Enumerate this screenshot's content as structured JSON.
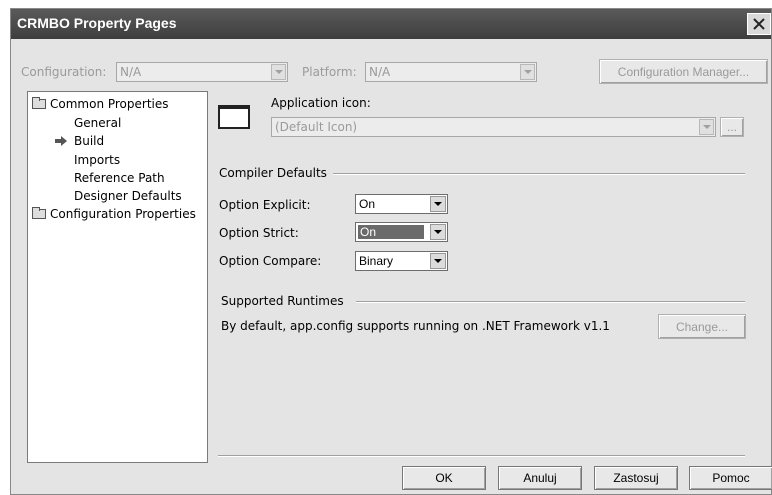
{
  "window": {
    "title": "CRMBO Property Pages"
  },
  "top": {
    "configuration_label": "Configuration:",
    "configuration_value": "N/A",
    "platform_label": "Platform:",
    "platform_value": "N/A",
    "config_manager_label": "Configuration Manager..."
  },
  "tree": {
    "common_properties": "Common Properties",
    "items": [
      "General",
      "Build",
      "Imports",
      "Reference Path",
      "Designer Defaults"
    ],
    "selected": "Build",
    "configuration_properties": "Configuration Properties"
  },
  "app_icon": {
    "label": "Application icon:",
    "value": "(Default Icon)",
    "browse_label": "..."
  },
  "compiler": {
    "section_title": "Compiler Defaults",
    "explicit_label": "Option Explicit:",
    "explicit_value": "On",
    "strict_label": "Option Strict:",
    "strict_value": "On",
    "compare_label": "Option Compare:",
    "compare_value": "Binary"
  },
  "runtimes": {
    "section_title": "Supported Runtimes",
    "description": "By default, app.config supports running on .NET Framework v1.1",
    "change_label": "Change..."
  },
  "buttons": {
    "ok": "OK",
    "cancel": "Anuluj",
    "apply": "Zastosuj",
    "help": "Pomoc"
  }
}
